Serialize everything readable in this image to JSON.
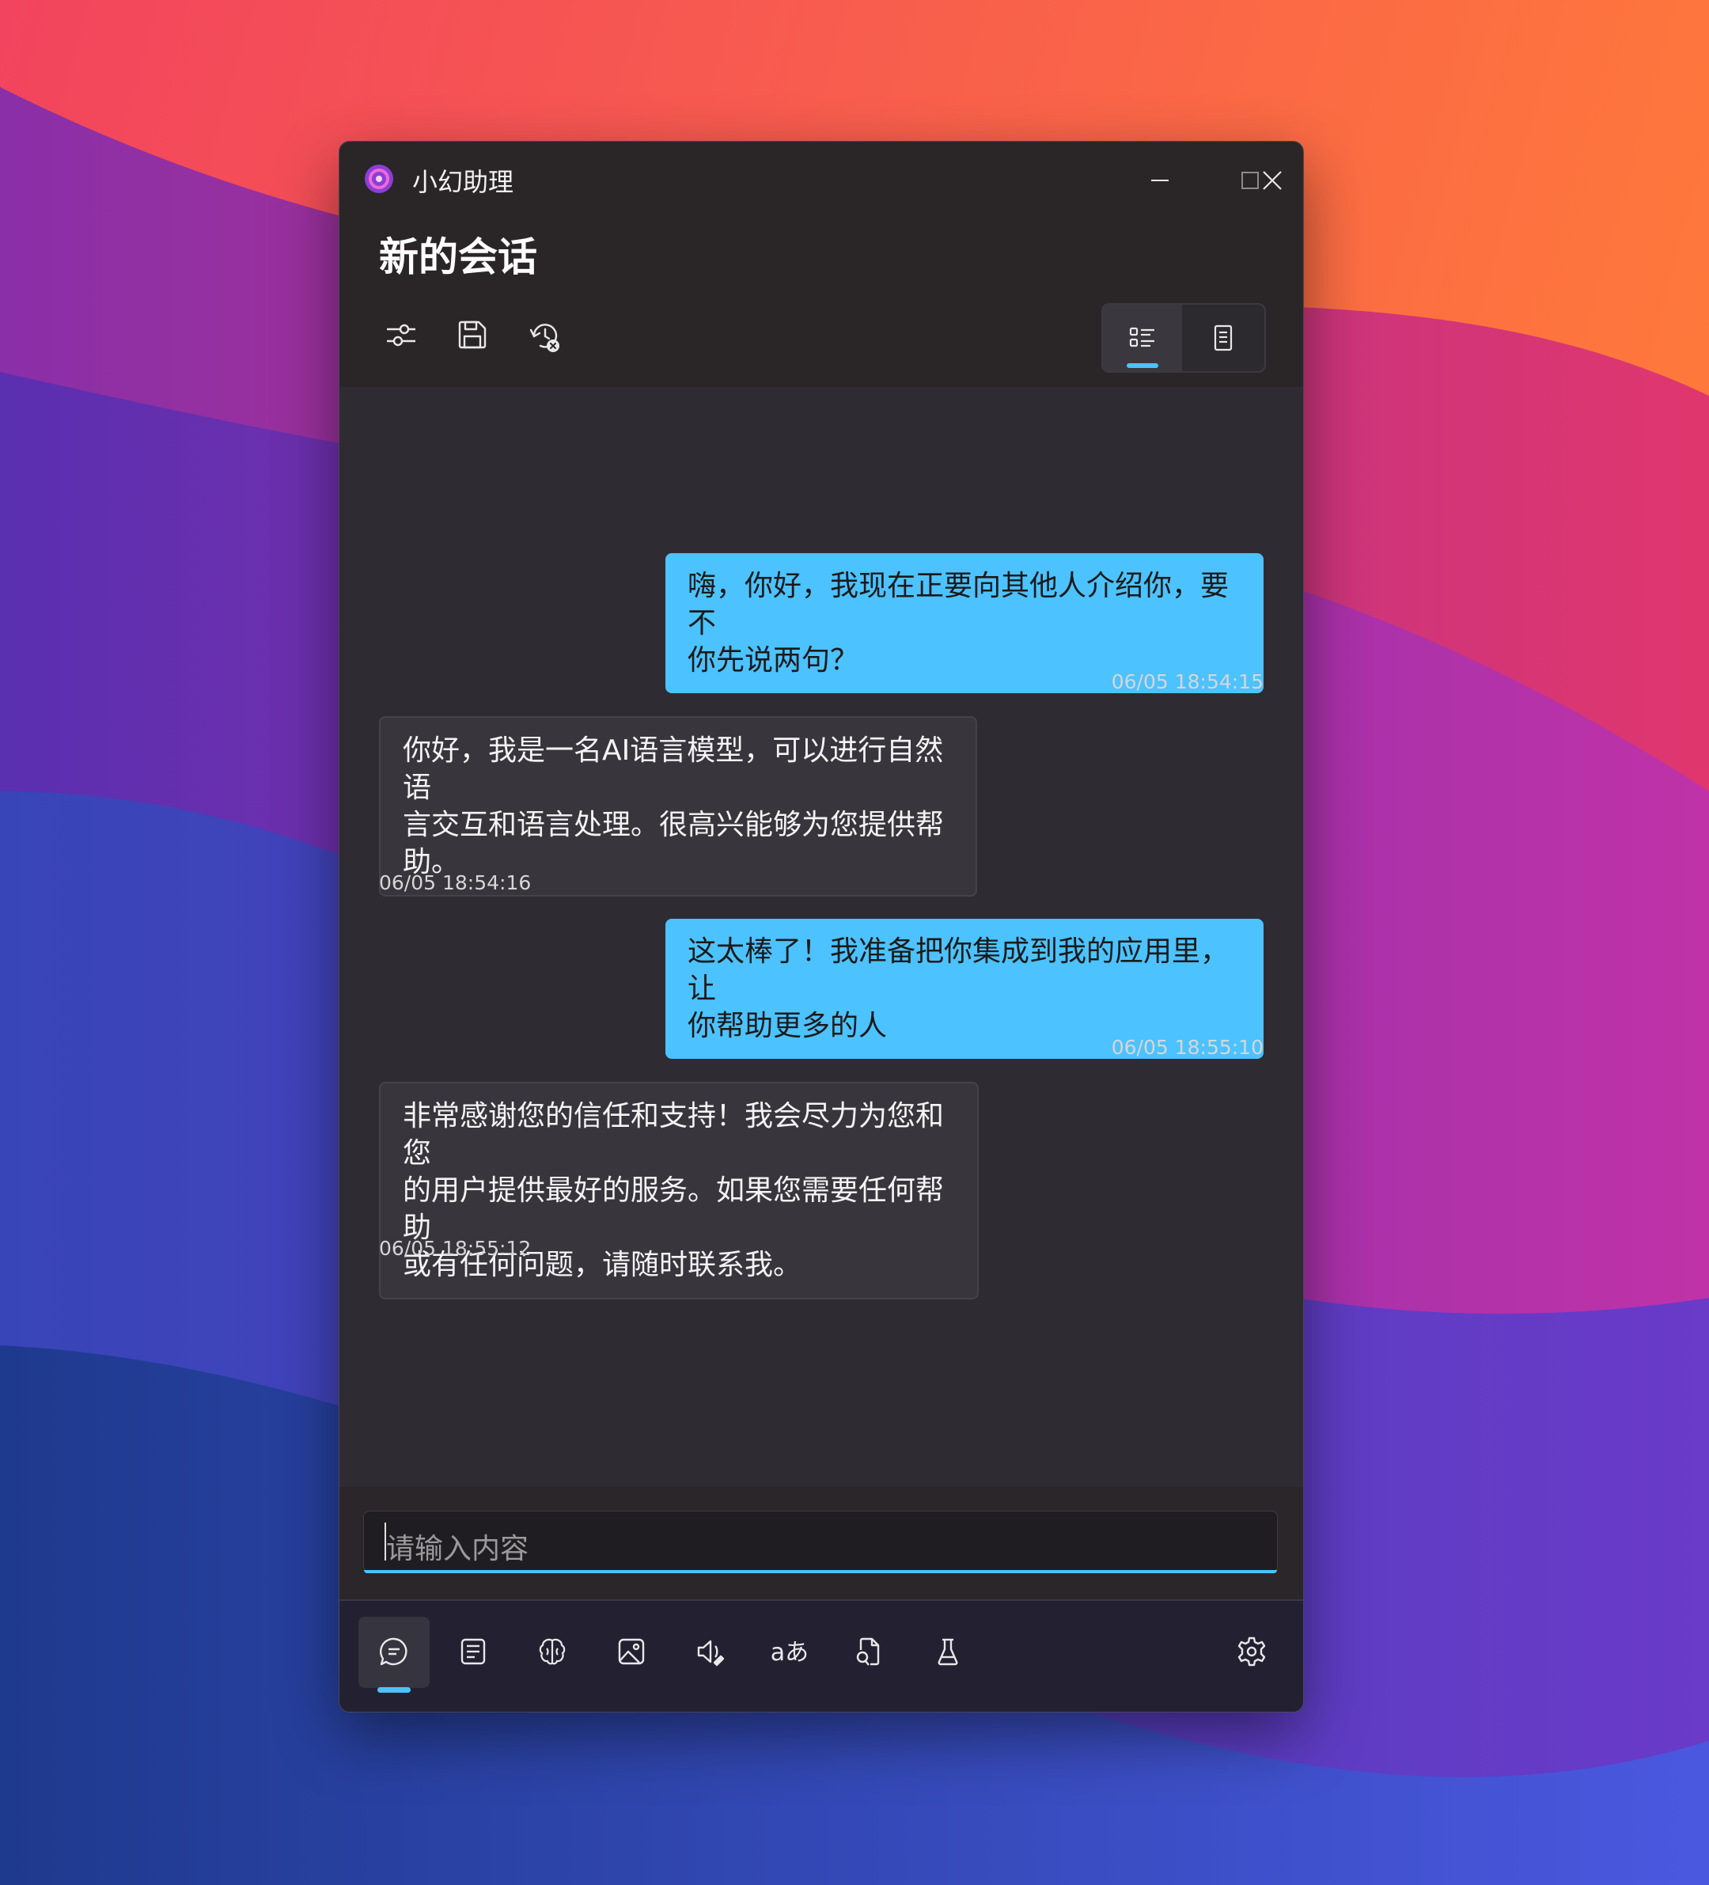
{
  "app": {
    "title": "小幻助理",
    "page_title": "新的会话"
  },
  "toolbar": {
    "icons": [
      "sliders-icon",
      "save-icon",
      "clear-history-icon"
    ]
  },
  "view_toggle": {
    "options": [
      "list-view-icon",
      "document-view-icon"
    ],
    "selected": "list-view-icon"
  },
  "messages": [
    {
      "role": "user",
      "text": "嗨，你好，我现在正要向其他人介绍你，要不\n你先说两句？",
      "time": "06/05 18:54:15"
    },
    {
      "role": "assistant",
      "text": "你好，我是一名AI语言模型，可以进行自然语\n言交互和语言处理。很高兴能够为您提供帮\n助。",
      "time": "06/05 18:54:16"
    },
    {
      "role": "user",
      "text": "这太棒了！我准备把你集成到我的应用里，让\n你帮助更多的人",
      "time": "06/05 18:55:10"
    },
    {
      "role": "assistant",
      "text": "非常感谢您的信任和支持！我会尽力为您和您\n的用户提供最好的服务。如果您需要任何帮助\n或有任何问题，请随时联系我。",
      "time": "06/05 18:55:12"
    }
  ],
  "input": {
    "placeholder": "请输入内容",
    "value": ""
  },
  "nav": {
    "items": [
      "chat-icon",
      "notes-icon",
      "brain-icon",
      "image-icon",
      "speech-icon",
      "translate-icon",
      "document-search-icon",
      "lab-icon"
    ],
    "translate_label": "aあ",
    "selected": "chat-icon",
    "settings": "settings-icon"
  },
  "colors": {
    "accent": "#4cc2ff",
    "window_bg": "#2e2b33",
    "bot_bubble": "#38353c"
  }
}
